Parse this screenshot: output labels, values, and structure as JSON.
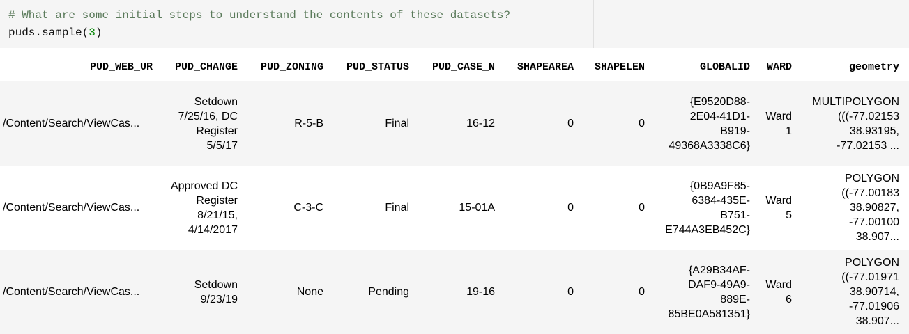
{
  "input_cell": {
    "comment": "# What are some initial steps to understand the contents of these datasets?",
    "code_fn": "puds.sample(",
    "code_arg": "3",
    "code_close": ")"
  },
  "table": {
    "columns": [
      "PUD_WEB_UR",
      "PUD_CHANGE",
      "PUD_ZONING",
      "PUD_STATUS",
      "PUD_CASE_N",
      "SHAPEAREA",
      "SHAPELEN",
      "GLOBALID",
      "WARD",
      "geometry"
    ],
    "rows": [
      {
        "PUD_WEB_UR": "/Content/Search/ViewCas...",
        "PUD_CHANGE": "Setdown\n7/25/16, DC\nRegister\n5/5/17",
        "PUD_ZONING": "R-5-B",
        "PUD_STATUS": "Final",
        "PUD_CASE_N": "16-12",
        "SHAPEAREA": "0",
        "SHAPELEN": "0",
        "GLOBALID": "{E9520D88-\n2E04-41D1-\nB919-\n49368A3338C6}",
        "WARD": "Ward\n1",
        "geometry": "MULTIPOLYGON\n(((-77.02153\n38.93195,\n-77.02153 ..."
      },
      {
        "PUD_WEB_UR": "/Content/Search/ViewCas...",
        "PUD_CHANGE": "Approved DC\nRegister\n8/21/15,\n4/14/2017",
        "PUD_ZONING": "C-3-C",
        "PUD_STATUS": "Final",
        "PUD_CASE_N": "15-01A",
        "SHAPEAREA": "0",
        "SHAPELEN": "0",
        "GLOBALID": "{0B9A9F85-\n6384-435E-\nB751-\nE744A3EB452C}",
        "WARD": "Ward\n5",
        "geometry": "POLYGON\n((-77.00183\n38.90827,\n-77.00100\n38.907..."
      },
      {
        "PUD_WEB_UR": "/Content/Search/ViewCas...",
        "PUD_CHANGE": "Setdown\n9/23/19",
        "PUD_ZONING": "None",
        "PUD_STATUS": "Pending",
        "PUD_CASE_N": "19-16",
        "SHAPEAREA": "0",
        "SHAPELEN": "0",
        "GLOBALID": "{A29B34AF-\nDAF9-49A9-\n889E-\n85BE0A581351}",
        "WARD": "Ward\n6",
        "geometry": "POLYGON\n((-77.01971\n38.90714,\n-77.01906\n38.907..."
      }
    ]
  }
}
